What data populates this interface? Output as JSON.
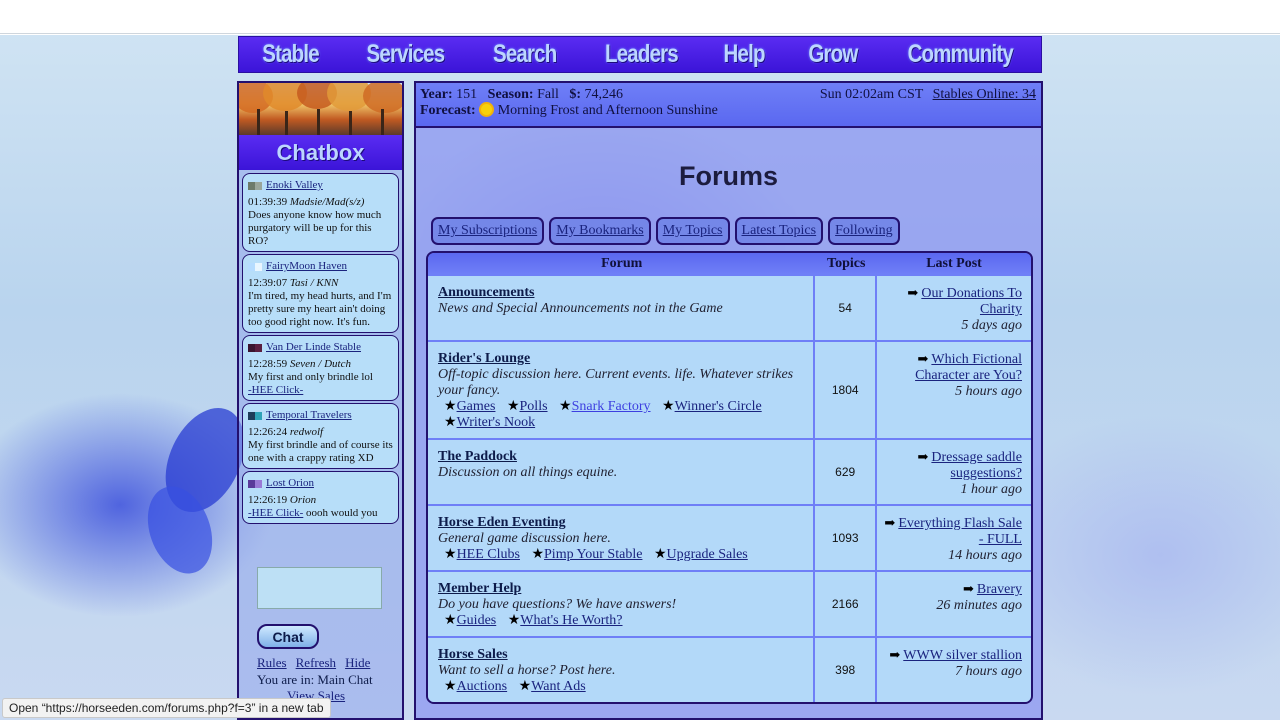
{
  "nav": {
    "items": [
      "Stable",
      "Services",
      "Search",
      "Leaders",
      "Help",
      "Grow",
      "Community"
    ]
  },
  "chat": {
    "title": "Chatbox",
    "messages": [
      {
        "stable": "Enoki Valley",
        "time": "01:39:39",
        "user": "Madsie/Mad(s/z)",
        "text": "Does anyone know how much purgatory will be up for this RO?",
        "flag": [
          "#6d7a6a",
          "#9aa59a"
        ]
      },
      {
        "stable": "FairyMoon Haven",
        "time": "12:39:07",
        "user": "Tasi / KNN",
        "text": "I'm tired, my head hurts, and I'm pretty sure my heart ain't doing too good right now. It's fun.",
        "flag": [
          "#b5dcff",
          "#e9f6ff"
        ]
      },
      {
        "stable": "Van Der Linde Stable",
        "time": "12:28:59",
        "user": "Seven / Dutch",
        "text": "My first and only brindle lol",
        "link": "-HEE Click-",
        "flag": [
          "#3a1630",
          "#5a1f40"
        ]
      },
      {
        "stable": "Temporal Travelers",
        "time": "12:26:24",
        "user": "redwolf",
        "text": "My first brindle and of course its one with a crappy rating XD",
        "flag": [
          "#1e3d5a",
          "#2ea3b8"
        ]
      },
      {
        "stable": "Lost Orion",
        "time": "12:26:19",
        "user": "Orion",
        "text": "oooh would you",
        "link": "-HEE Click-",
        "flag": [
          "#5a3a9a",
          "#9a7ad6"
        ]
      }
    ],
    "send_label": "Chat",
    "links": [
      "Rules",
      "Refresh",
      "Hide"
    ],
    "room": "You are in: Main Chat",
    "view_sales": "View Sales"
  },
  "info": {
    "year_label": "Year:",
    "year": "151",
    "season_label": "Season:",
    "season": "Fall",
    "money_label": "$:",
    "money": "74,246",
    "forecast_label": "Forecast:",
    "forecast": "Morning Frost and Afternoon Sunshine",
    "clock": "Sun 02:02am CST",
    "online": "Stables Online: 34"
  },
  "page_title": "Forums",
  "tabs": [
    "My Subscriptions",
    "My Bookmarks",
    "My Topics",
    "Latest Topics",
    "Following"
  ],
  "table": {
    "headers": [
      "Forum",
      "Topics",
      "Last Post"
    ],
    "rows": [
      {
        "name": "Announcements",
        "desc": "News and Special Announcements not in the Game",
        "subs": [],
        "topics": "54",
        "last_post": "Our Donations To Charity",
        "last_time": "5 days ago"
      },
      {
        "name": "Rider's Lounge",
        "desc": "Off-topic discussion here. Current events. life. Whatever strikes your fancy.",
        "subs": [
          "Games",
          "Polls",
          "Snark Factory",
          "Winner's Circle",
          "Writer's Nook"
        ],
        "topics": "1804",
        "last_post": "Which Fictional Character are You?",
        "last_time": "5 hours ago"
      },
      {
        "name": "The Paddock",
        "desc": "Discussion on all things equine.",
        "subs": [],
        "topics": "629",
        "last_post": "Dressage saddle suggestions?",
        "last_time": "1 hour ago"
      },
      {
        "name": "Horse Eden Eventing",
        "desc": "General game discussion here.",
        "subs": [
          "HEE Clubs",
          "Pimp Your Stable",
          "Upgrade Sales"
        ],
        "topics": "1093",
        "last_post": "Everything Flash Sale - FULL",
        "last_time": "14 hours ago"
      },
      {
        "name": "Member Help",
        "desc": "Do you have questions? We have answers!",
        "subs": [
          "Guides",
          "What's He Worth?"
        ],
        "topics": "2166",
        "last_post": "Bravery",
        "last_time": "26 minutes ago"
      },
      {
        "name": "Horse Sales",
        "desc": "Want to sell a horse? Post here.",
        "subs": [
          "Auctions",
          "Want Ads"
        ],
        "topics": "398",
        "last_post": "WWW silver stallion",
        "last_time": "7 hours ago"
      }
    ]
  },
  "statusbar": "Open “https://horseeden.com/forums.php?f=3” in a new tab"
}
